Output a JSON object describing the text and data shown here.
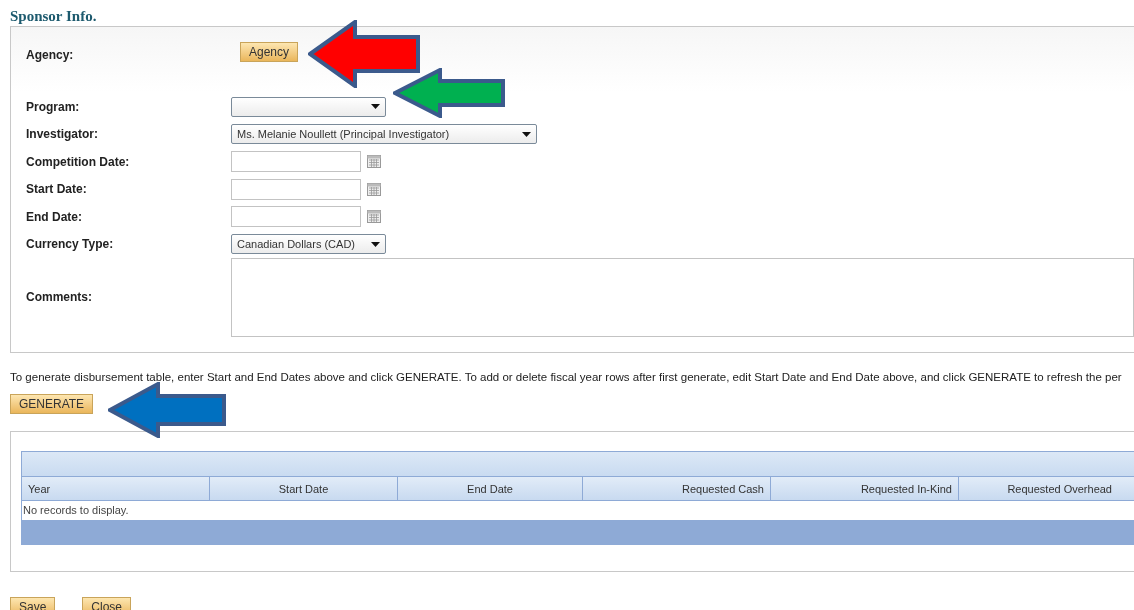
{
  "section_title": "Sponsor Info.",
  "fields": [
    {
      "kind": "button",
      "label": "Agency:",
      "button": "Agency"
    },
    {
      "kind": "select",
      "label": "Program:"
    },
    {
      "kind": "select",
      "label": "Investigator:",
      "value": "Ms. Melanie Noullett (Principal Investigator)"
    },
    {
      "kind": "date",
      "label": "Competition Date:"
    },
    {
      "kind": "date",
      "label": "Start Date:"
    },
    {
      "kind": "date",
      "label": "End Date:"
    },
    {
      "kind": "select",
      "label": "Currency Type:",
      "value": "Canadian Dollars (CAD)"
    },
    {
      "kind": "textarea",
      "label": "Comments:"
    }
  ],
  "instructions": "To generate disbursement table, enter Start and End Dates above and click GENERATE. To add or delete fiscal year rows after first generate, edit Start Date and End Date above, and click GENERATE to refresh the per",
  "generate_button": "GENERATE",
  "table": {
    "columns": [
      "Year",
      "Start Date",
      "End Date",
      "Requested Cash",
      "Requested In-Kind",
      "Requested Overhead"
    ],
    "empty_message": "No records to display."
  },
  "buttons": [
    "Save",
    "Close"
  ],
  "annotations": [
    {
      "color": "#ff0000"
    },
    {
      "color": "#00b050"
    },
    {
      "color": "#0070c0"
    }
  ]
}
